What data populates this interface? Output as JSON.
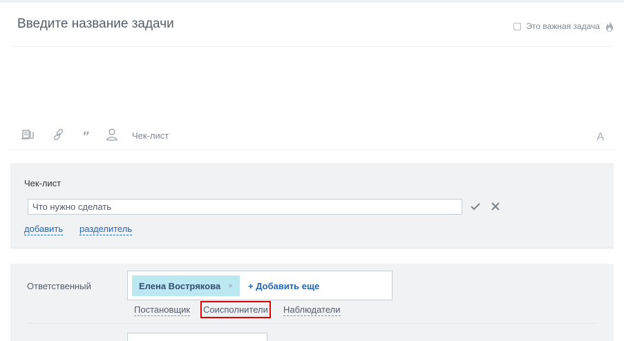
{
  "task": {
    "title_placeholder": "Введите название задачи",
    "important_label": "Это важная задача"
  },
  "toolbar": {
    "checklist_label": "Чек-лист",
    "font_label": "A"
  },
  "checklist": {
    "title": "Чек-лист",
    "input_placeholder": "Что нужно сделать",
    "add_link": "добавить",
    "separator_link": "разделитель"
  },
  "people": {
    "responsible_label": "Ответственный",
    "assignee_chip": "Елена Вострякова",
    "chip_remove": "×",
    "add_more": "+ Добавить еще",
    "role_creator": "Постановщик",
    "role_coexecutors": "Соисполнители",
    "role_observers": "Наблюдатели"
  },
  "colors": {
    "link": "#2067b0",
    "chip_bg": "#bce8f1",
    "highlight": "#e10000"
  }
}
